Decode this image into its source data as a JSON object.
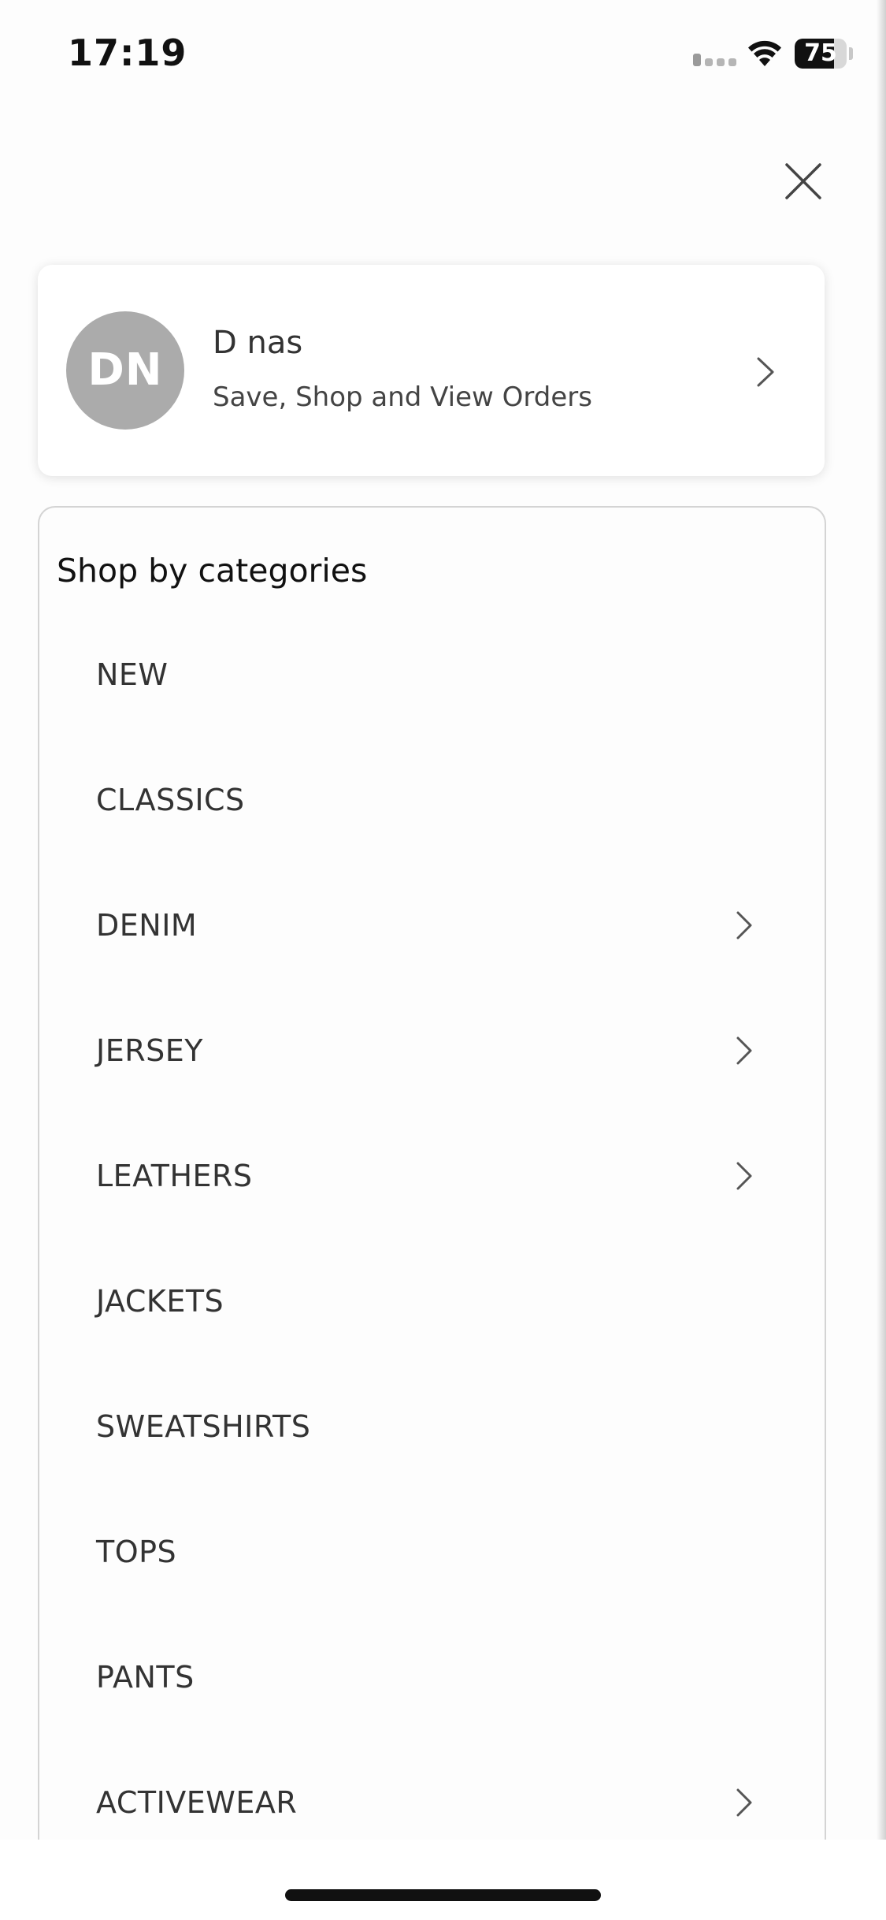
{
  "status_bar": {
    "time": "17:19",
    "battery_level": "75",
    "battery_fraction": 0.75
  },
  "header": {
    "close_icon": "close-icon"
  },
  "profile": {
    "initials": "DN",
    "name": "D nas",
    "subtitle": "Save, Shop and View Orders",
    "avatar_color": "#ababab"
  },
  "categories": {
    "heading": "Shop by categories",
    "items": [
      {
        "label": "NEW",
        "has_submenu": false
      },
      {
        "label": "CLASSICS",
        "has_submenu": false
      },
      {
        "label": "DENIM",
        "has_submenu": true
      },
      {
        "label": "JERSEY",
        "has_submenu": true
      },
      {
        "label": "LEATHERS",
        "has_submenu": true
      },
      {
        "label": "JACKETS",
        "has_submenu": false
      },
      {
        "label": "SWEATSHIRTS",
        "has_submenu": false
      },
      {
        "label": "TOPS",
        "has_submenu": false
      },
      {
        "label": "PANTS",
        "has_submenu": false
      },
      {
        "label": "ACTIVEWEAR",
        "has_submenu": true
      }
    ]
  },
  "colors": {
    "text_primary": "#333333",
    "heading": "#111111",
    "chevron": "#555555",
    "panel_border": "#d4d4d4"
  }
}
